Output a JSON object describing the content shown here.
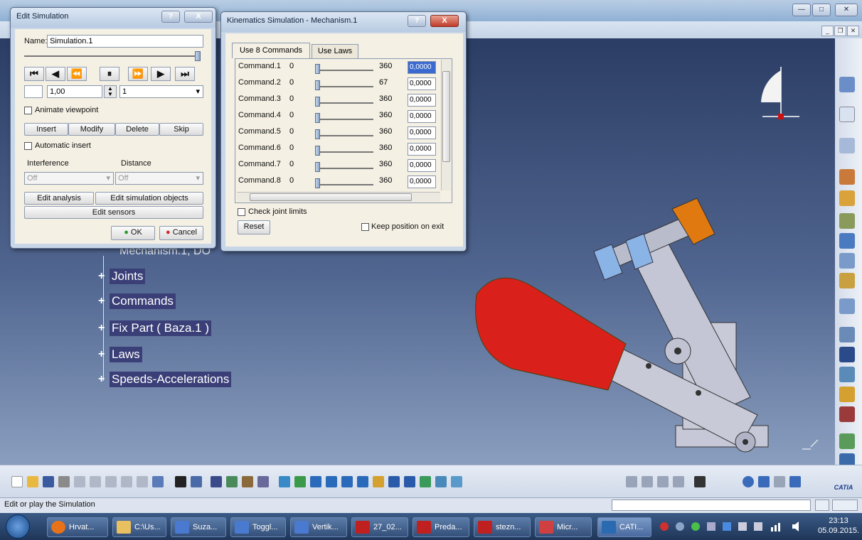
{
  "edit_simulation": {
    "title": "Edit Simulation",
    "name_label": "Name:",
    "name_value": "Simulation.1",
    "step_value": "1,00",
    "step_select": "1",
    "animate_viewpoint": "Animate viewpoint",
    "insert": "Insert",
    "modify": "Modify",
    "delete": "Delete",
    "skip": "Skip",
    "automatic_insert": "Automatic insert",
    "interference_label": "Interference",
    "distance_label": "Distance",
    "interference_value": "Off",
    "distance_value": "Off",
    "edit_analysis": "Edit analysis",
    "edit_sim_objects": "Edit simulation objects",
    "edit_sensors": "Edit sensors",
    "ok": "OK",
    "cancel": "Cancel",
    "help": "?",
    "close": "X"
  },
  "kinematics": {
    "title": "Kinematics Simulation - Mechanism.1",
    "tab_commands": "Use 8 Commands",
    "tab_laws": "Use Laws",
    "commands": [
      {
        "name": "Command.1",
        "min": "0",
        "max": "360",
        "value": "0,0000"
      },
      {
        "name": "Command.2",
        "min": "0",
        "max": "67",
        "value": "0,0000"
      },
      {
        "name": "Command.3",
        "min": "0",
        "max": "360",
        "value": "0,0000"
      },
      {
        "name": "Command.4",
        "min": "0",
        "max": "360",
        "value": "0,0000"
      },
      {
        "name": "Command.5",
        "min": "0",
        "max": "360",
        "value": "0,0000"
      },
      {
        "name": "Command.6",
        "min": "0",
        "max": "360",
        "value": "0,0000"
      },
      {
        "name": "Command.7",
        "min": "0",
        "max": "360",
        "value": "0,0000"
      },
      {
        "name": "Command.8",
        "min": "0",
        "max": "360",
        "value": "0,0000"
      }
    ],
    "check_joint_limits": "Check joint limits",
    "reset": "Reset",
    "keep_position": "Keep position on exit",
    "help": "?",
    "close": "X"
  },
  "tree": {
    "mechanism_partial": "Mechanism.1, DO",
    "items": [
      "Joints",
      "Commands",
      "Fix Part ( Baza.1 )",
      "Laws",
      "Speeds-Accelerations"
    ]
  },
  "status_text": "Edit or play the Simulation",
  "catia_logo": "CATIA",
  "taskbar": {
    "items": [
      "Hrvat...",
      "C:\\Us...",
      "Suza...",
      "Toggl...",
      "Vertik...",
      "27_02...",
      "Preda...",
      "stezn...",
      "Micr...",
      "CATI..."
    ],
    "time": "23:13",
    "date": "05.09.2015."
  },
  "colors": {
    "viewport_top": "#2b3d64",
    "tree_highlight": "#3a3f78",
    "handle_red": "#d9201a",
    "nut_orange": "#e07a10",
    "part_grey": "#c9cad8"
  }
}
